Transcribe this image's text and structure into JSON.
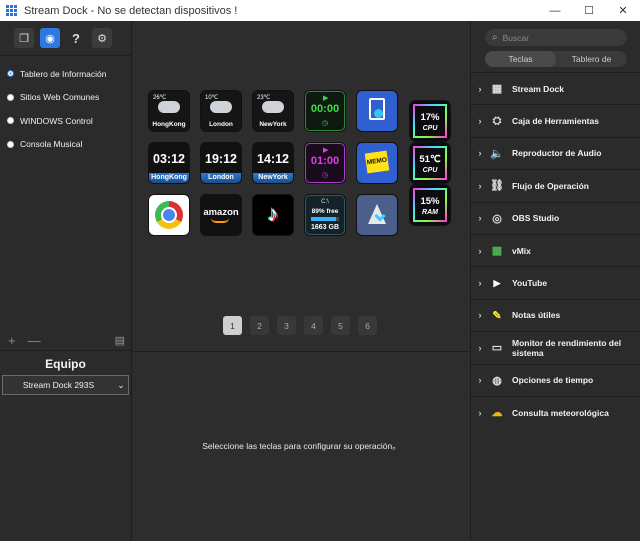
{
  "window": {
    "title": "Stream Dock - No se detectan dispositivos !",
    "minimize": "—",
    "maximize": "☐",
    "close": "✕"
  },
  "left": {
    "toolbar": [
      {
        "name": "profiles-icon",
        "glyph": "❐"
      },
      {
        "name": "store-icon",
        "glyph": "◉"
      },
      {
        "name": "help-icon",
        "glyph": "?"
      },
      {
        "name": "gear-icon",
        "glyph": "⚙"
      }
    ],
    "profiles": [
      {
        "label": "Tablero de Información",
        "selected": true
      },
      {
        "label": "Sitios Web Comunes",
        "selected": false
      },
      {
        "label": "WINDOWS Control",
        "selected": false
      },
      {
        "label": "Consola Musical",
        "selected": false
      }
    ],
    "add_glyph": "+",
    "remove_glyph": "—",
    "manage_glyph": "▤",
    "equipo_label": "Equipo",
    "device": "Stream Dock 293S",
    "device_chevron": "⌄"
  },
  "keys": {
    "weather1": {
      "temp": "26℃",
      "city": "HongKong"
    },
    "weather2": {
      "temp": "10℃",
      "city": "London"
    },
    "weather3": {
      "temp": "23℃",
      "city": "NewYork"
    },
    "timer1": {
      "time": "00:00",
      "play": "▶",
      "sub": "◷"
    },
    "clock1": {
      "time": "03:12",
      "city": "HongKong"
    },
    "clock2": {
      "time": "19:12",
      "city": "London"
    },
    "clock3": {
      "time": "14:12",
      "city": "NewYork"
    },
    "timer2": {
      "time": "01:00",
      "play": "▶",
      "sub": "◷"
    },
    "memo": {
      "label": "MEMO"
    },
    "amazon": {
      "label": "amazon"
    },
    "tiktok": {
      "glyph": "♪"
    },
    "disk": {
      "drive": "C:\\",
      "free": "89% free",
      "size": "1663 GB",
      "fill": 0.89
    },
    "cpu1": {
      "value": "17%",
      "unit": "CPU"
    },
    "cpu2": {
      "value": "51℃",
      "unit": "CPU"
    },
    "ram": {
      "value": "15%",
      "unit": "RAM"
    }
  },
  "pager": {
    "pages": [
      "1",
      "2",
      "3",
      "4",
      "5",
      "6"
    ],
    "current": 0
  },
  "hint": "Seleccione las teclas para configurar su operación。",
  "right": {
    "search_placeholder": "Buscar",
    "search_glyph": "⌕",
    "tabs": [
      "Teclas",
      "Tablero de"
    ],
    "categories": [
      {
        "label": "Stream Dock",
        "icon": "grid-icon",
        "glyph": "▦"
      },
      {
        "label": "Caja de Herramientas",
        "icon": "toolbox-icon",
        "glyph": "⛭"
      },
      {
        "label": "Reproductor de Audio",
        "icon": "speaker-icon",
        "glyph": "🔈"
      },
      {
        "label": "Flujo de Operación",
        "icon": "flow-icon",
        "glyph": "⛓"
      },
      {
        "label": "OBS Studio",
        "icon": "obs-icon",
        "glyph": "◎"
      },
      {
        "label": "vMix",
        "icon": "vmix-icon",
        "glyph": "▦"
      },
      {
        "label": "YouTube",
        "icon": "youtube-icon",
        "glyph": "▶"
      },
      {
        "label": "Notas útiles",
        "icon": "sticky-note-icon",
        "glyph": "✎"
      },
      {
        "label": "Monitor de rendimiento del sistema",
        "icon": "monitor-icon",
        "glyph": "▭"
      },
      {
        "label": "Opciones de tiempo",
        "icon": "globe-icon",
        "glyph": "◍"
      },
      {
        "label": "Consulta meteorológica",
        "icon": "weather-icon",
        "glyph": "☁"
      }
    ],
    "chevron": "›"
  }
}
